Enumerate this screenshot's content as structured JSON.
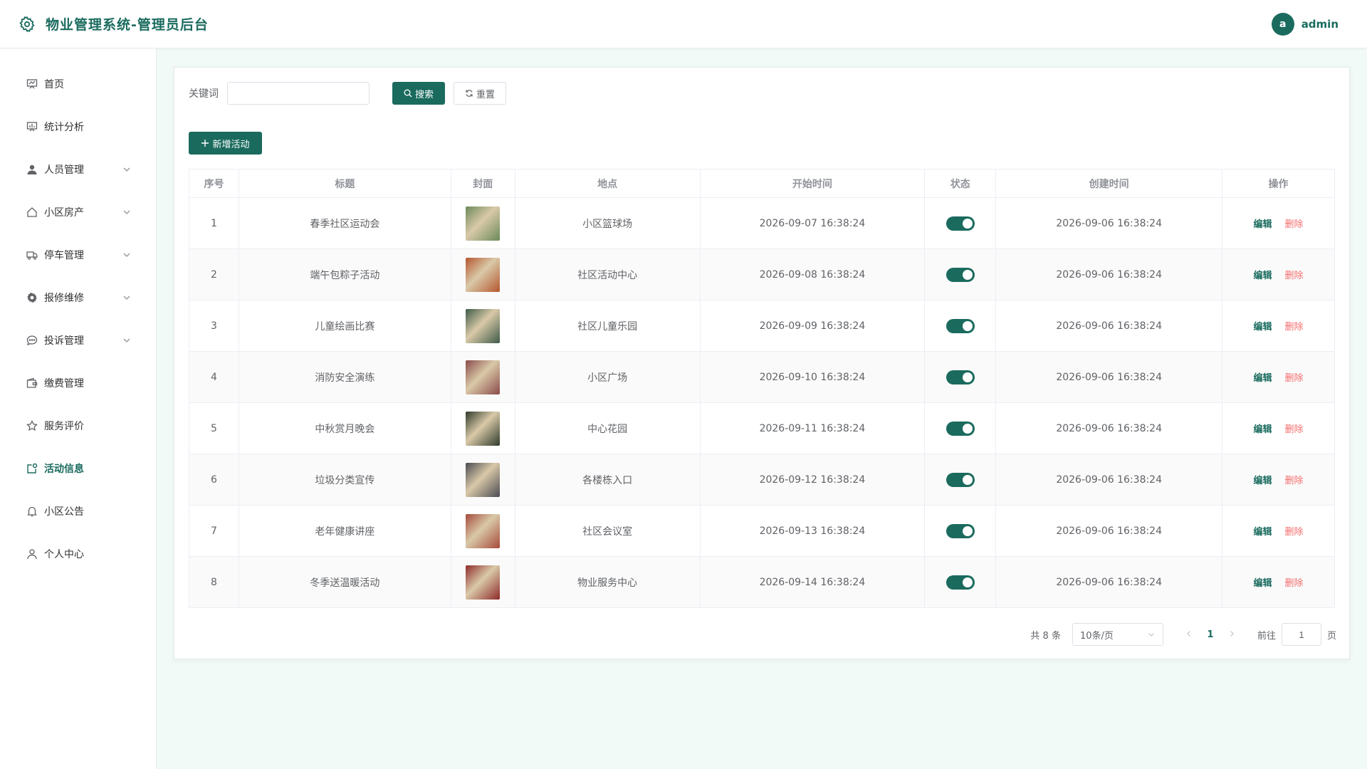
{
  "header": {
    "title": "物业管理系统-管理员后台",
    "avatar_letter": "a",
    "username": "admin"
  },
  "sidebar": {
    "items": [
      {
        "label": "首页",
        "icon": "home-chart-icon",
        "expandable": false
      },
      {
        "label": "统计分析",
        "icon": "stats-chart-icon",
        "expandable": false
      },
      {
        "label": "人员管理",
        "icon": "user-icon",
        "expandable": true
      },
      {
        "label": "小区房产",
        "icon": "house-icon",
        "expandable": true
      },
      {
        "label": "停车管理",
        "icon": "truck-icon",
        "expandable": true
      },
      {
        "label": "报修维修",
        "icon": "gear-icon",
        "expandable": true
      },
      {
        "label": "投诉管理",
        "icon": "chat-icon",
        "expandable": true
      },
      {
        "label": "缴费管理",
        "icon": "wallet-icon",
        "expandable": false
      },
      {
        "label": "服务评价",
        "icon": "star-icon",
        "expandable": false
      },
      {
        "label": "活动信息",
        "icon": "activity-icon",
        "expandable": false,
        "active": true
      },
      {
        "label": "小区公告",
        "icon": "bell-icon",
        "expandable": false
      },
      {
        "label": "个人中心",
        "icon": "person-icon",
        "expandable": false
      }
    ]
  },
  "search": {
    "label": "关键词",
    "placeholder": "",
    "value": "",
    "search_btn": "搜索",
    "reset_btn": "重置"
  },
  "toolbar": {
    "add_btn": "新增活动"
  },
  "table": {
    "columns": [
      "序号",
      "标题",
      "封面",
      "地点",
      "开始时间",
      "状态",
      "创建时间",
      "操作"
    ],
    "rows": [
      {
        "no": "1",
        "title": "春季社区运动会",
        "location": "小区篮球场",
        "start": "2026-09-07 16:38:24",
        "created": "2026-09-06 16:38:24",
        "status": true,
        "cover_color": "#6b8a5a"
      },
      {
        "no": "2",
        "title": "端午包粽子活动",
        "location": "社区活动中心",
        "start": "2026-09-08 16:38:24",
        "created": "2026-09-06 16:38:24",
        "status": true,
        "cover_color": "#b5562e"
      },
      {
        "no": "3",
        "title": "儿童绘画比赛",
        "location": "社区儿童乐园",
        "start": "2026-09-09 16:38:24",
        "created": "2026-09-06 16:38:24",
        "status": true,
        "cover_color": "#3d5a48"
      },
      {
        "no": "4",
        "title": "消防安全演练",
        "location": "小区广场",
        "start": "2026-09-10 16:38:24",
        "created": "2026-09-06 16:38:24",
        "status": true,
        "cover_color": "#8a4a4a"
      },
      {
        "no": "5",
        "title": "中秋赏月晚会",
        "location": "中心花园",
        "start": "2026-09-11 16:38:24",
        "created": "2026-09-06 16:38:24",
        "status": true,
        "cover_color": "#2e3a2a"
      },
      {
        "no": "6",
        "title": "垃圾分类宣传",
        "location": "各楼栋入口",
        "start": "2026-09-12 16:38:24",
        "created": "2026-09-06 16:38:24",
        "status": true,
        "cover_color": "#4a4a52"
      },
      {
        "no": "7",
        "title": "老年健康讲座",
        "location": "社区会议室",
        "start": "2026-09-13 16:38:24",
        "created": "2026-09-06 16:38:24",
        "status": true,
        "cover_color": "#a64a3a"
      },
      {
        "no": "8",
        "title": "冬季送温暖活动",
        "location": "物业服务中心",
        "start": "2026-09-14 16:38:24",
        "created": "2026-09-06 16:38:24",
        "status": true,
        "cover_color": "#8e2a2a"
      }
    ],
    "edit_label": "编辑",
    "delete_label": "删除"
  },
  "pagination": {
    "total_text": "共 8 条",
    "page_size": "10条/页",
    "current_page": "1",
    "goto_label": "前往",
    "goto_value": "1",
    "page_suffix": "页"
  },
  "colors": {
    "brand": "#1a6b5e",
    "danger": "#f56c6c",
    "background": "#f2faf8"
  }
}
